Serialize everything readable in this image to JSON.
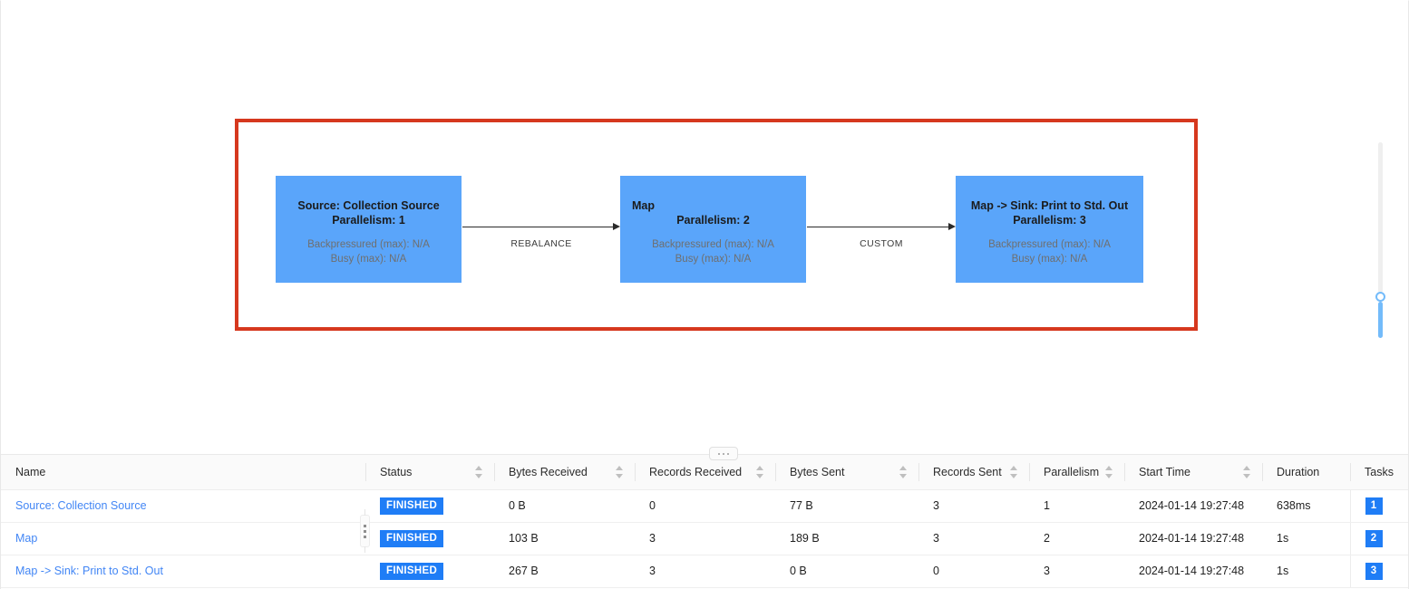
{
  "graph": {
    "selection_border_color": "#d6381e",
    "node_color": "#5aa5fa",
    "nodes": [
      {
        "title": "Source: Collection Source",
        "parallelism": "Parallelism: 1",
        "backpressured": "Backpressured (max): N/A",
        "busy": "Busy (max): N/A"
      },
      {
        "title": "Map",
        "parallelism": "Parallelism: 2",
        "backpressured": "Backpressured (max): N/A",
        "busy": "Busy (max): N/A"
      },
      {
        "title": "Map -> Sink: Print to Std. Out",
        "parallelism": "Parallelism: 3",
        "backpressured": "Backpressured (max): N/A",
        "busy": "Busy (max): N/A"
      }
    ],
    "edges": [
      {
        "label": "REBALANCE"
      },
      {
        "label": "CUSTOM"
      }
    ]
  },
  "zoom_slider": {
    "accent_color": "#73bbfa"
  },
  "table": {
    "columns": [
      {
        "label": "Name",
        "sortable": false
      },
      {
        "label": "Status",
        "sortable": true
      },
      {
        "label": "Bytes Received",
        "sortable": true
      },
      {
        "label": "Records Received",
        "sortable": true
      },
      {
        "label": "Bytes Sent",
        "sortable": true
      },
      {
        "label": "Records Sent",
        "sortable": true
      },
      {
        "label": "Parallelism",
        "sortable": true
      },
      {
        "label": "Start Time",
        "sortable": true
      },
      {
        "label": "Duration",
        "sortable": false
      },
      {
        "label": "Tasks",
        "sortable": false
      }
    ],
    "rows": [
      {
        "name": "Source: Collection Source",
        "status": "FINISHED",
        "bytes_received": "0 B",
        "records_received": "0",
        "bytes_sent": "77 B",
        "records_sent": "3",
        "parallelism": "1",
        "start_time": "2024-01-14 19:27:48",
        "duration": "638ms",
        "tasks": "1"
      },
      {
        "name": "Map",
        "status": "FINISHED",
        "bytes_received": "103 B",
        "records_received": "3",
        "bytes_sent": "189 B",
        "records_sent": "3",
        "parallelism": "2",
        "start_time": "2024-01-14 19:27:48",
        "duration": "1s",
        "tasks": "2"
      },
      {
        "name": "Map -> Sink: Print to Std. Out",
        "status": "FINISHED",
        "bytes_received": "267 B",
        "records_received": "3",
        "bytes_sent": "0 B",
        "records_sent": "0",
        "parallelism": "3",
        "start_time": "2024-01-14 19:27:48",
        "duration": "1s",
        "tasks": "3"
      }
    ]
  }
}
